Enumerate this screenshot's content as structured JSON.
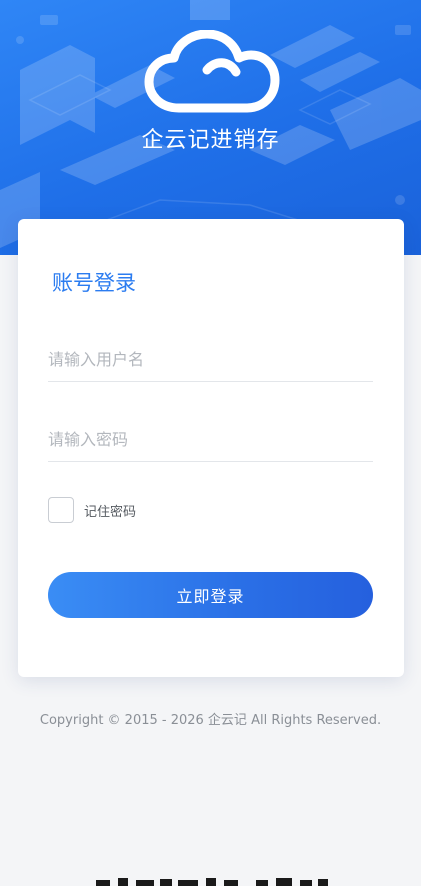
{
  "header": {
    "brand_name": "企云记进销存",
    "logo_icon": "cloud-icon",
    "background_color": "#2270ea"
  },
  "login_card": {
    "title": "账号登录",
    "username_placeholder": "请输入用户名",
    "username_value": "",
    "password_placeholder": "请输入密码",
    "password_value": "",
    "remember_label": "记住密码",
    "remember_checked": false,
    "submit_label": "立即登录"
  },
  "footer": {
    "copyright": "Copyright © 2015 - 2026 企云记 All Rights Reserved."
  },
  "colors": {
    "accent": "#2b7cf0",
    "button_start": "#3a8df5",
    "button_end": "#2560de",
    "page_bg": "#f4f5f7"
  }
}
